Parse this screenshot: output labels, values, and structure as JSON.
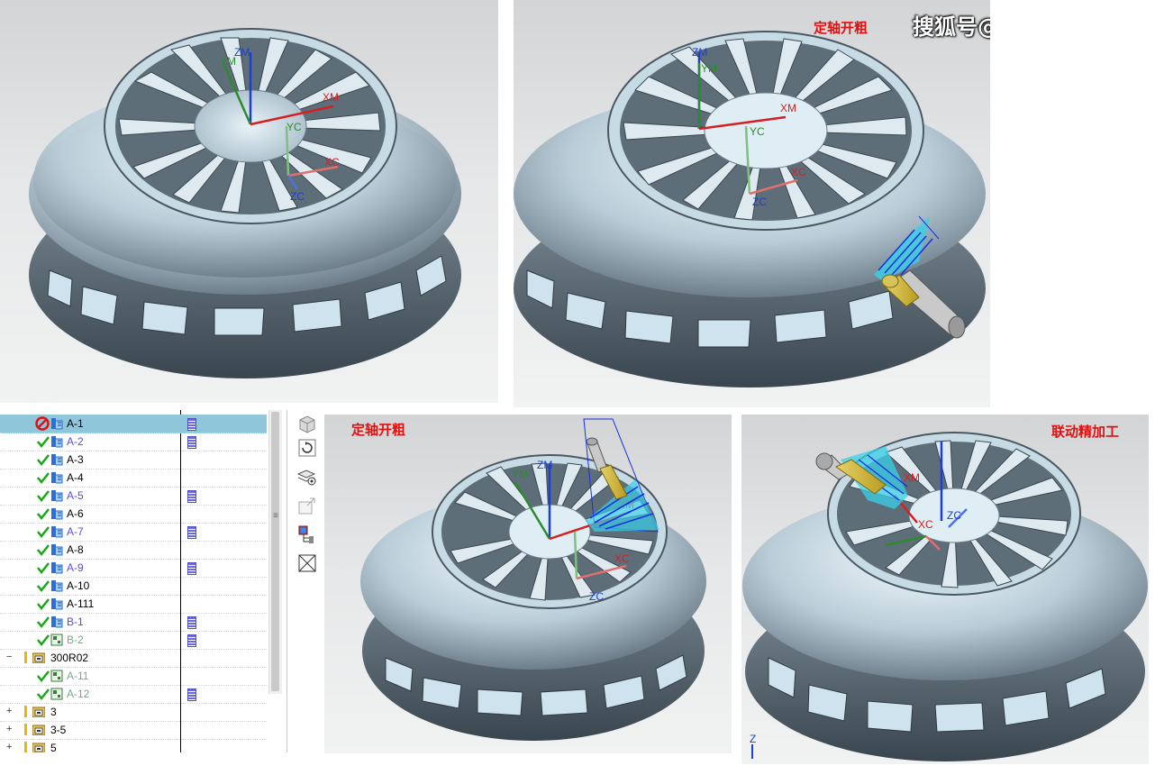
{
  "panels": {
    "top_left": {
      "axes": [
        "ZM",
        "YM",
        "XM",
        "YC",
        "XC",
        "ZC"
      ]
    },
    "top_right": {
      "caption": "定轴开粗",
      "watermark": "搜狐号@正版UG软件",
      "axes": [
        "ZM",
        "YM",
        "XM",
        "YC",
        "XC",
        "ZC"
      ]
    },
    "bottom_middle": {
      "caption": "定轴开粗",
      "axes": [
        "ZM",
        "YM",
        "XM",
        "XC",
        "ZC"
      ]
    },
    "bottom_right": {
      "caption": "联动精加工",
      "axes": [
        "XM",
        "XC",
        "ZC"
      ],
      "triad_label": "Z"
    }
  },
  "navigator": {
    "rows": [
      {
        "name": "A-1",
        "status": "banned",
        "color": "black",
        "tool": true,
        "selected": true
      },
      {
        "name": "A-2",
        "status": "check",
        "color": "blue",
        "tool": true
      },
      {
        "name": "A-3",
        "status": "check",
        "color": "black",
        "tool": false
      },
      {
        "name": "A-4",
        "status": "check",
        "color": "black",
        "tool": false
      },
      {
        "name": "A-5",
        "status": "check",
        "color": "blue",
        "tool": true
      },
      {
        "name": "A-6",
        "status": "check",
        "color": "black",
        "tool": false
      },
      {
        "name": "A-7",
        "status": "check",
        "color": "blue",
        "tool": true
      },
      {
        "name": "A-8",
        "status": "check",
        "color": "black",
        "tool": false
      },
      {
        "name": "A-9",
        "status": "check",
        "color": "blue",
        "tool": true
      },
      {
        "name": "A-10",
        "status": "check",
        "color": "black",
        "tool": false
      },
      {
        "name": "A-111",
        "status": "check",
        "color": "black",
        "tool": false
      },
      {
        "name": "B-1",
        "status": "check",
        "color": "blue",
        "tool": true
      },
      {
        "name": "B-2",
        "status": "check",
        "color": "green",
        "tool": true
      },
      {
        "name": "300R02",
        "status": "group",
        "color": "black",
        "tool": false
      },
      {
        "name": "A-11",
        "status": "check",
        "color": "green",
        "tool": false
      },
      {
        "name": "A-12",
        "status": "check",
        "color": "green",
        "tool": true
      },
      {
        "name": "3",
        "status": "group",
        "color": "black",
        "tool": false
      },
      {
        "name": "3-5",
        "status": "group",
        "color": "black",
        "tool": false
      },
      {
        "name": "5",
        "status": "group",
        "color": "black",
        "tool": false
      }
    ]
  },
  "resource_bar": {
    "icons": [
      "cube-icon",
      "history-icon",
      "settings-layers-icon",
      "export-icon",
      "assembly-navigator-icon",
      "close-box-icon"
    ]
  },
  "colors": {
    "selection": "#8fc6da",
    "caption": "#e01010",
    "op_blue": "#5a4ad8",
    "op_green": "#7aa88e"
  }
}
